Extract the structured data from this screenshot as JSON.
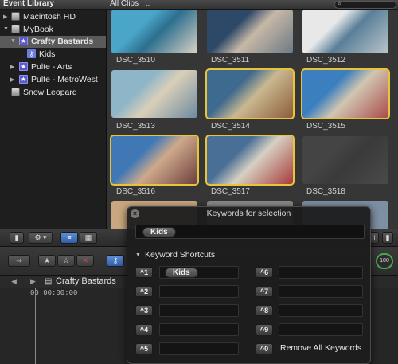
{
  "topbar": {
    "library_title": "Event Library",
    "clips_filter": "All Clips",
    "clips_chevron": "⌄",
    "search_glyph": "⌕"
  },
  "sidebar": {
    "items": [
      {
        "label": "Macintosh HD",
        "icon": "hard-disk-icon"
      },
      {
        "label": "MyBook",
        "icon": "hard-disk-icon"
      },
      {
        "label": "Crafty Bastards",
        "icon": "event-star-icon",
        "selected": true
      },
      {
        "label": "Kids",
        "icon": "keyword-collection-icon"
      },
      {
        "label": "Pulte - Arts",
        "icon": "event-star-icon"
      },
      {
        "label": "Pulte - MetroWest",
        "icon": "event-star-icon"
      },
      {
        "label": "Snow Leopard",
        "icon": "hard-disk-icon"
      }
    ]
  },
  "browser": {
    "clips": [
      {
        "name": "DSC_3510",
        "selected": false,
        "colors": [
          "#4aa6c9",
          "#2d6f8f",
          "#d9d3c4"
        ]
      },
      {
        "name": "DSC_3511",
        "selected": false,
        "colors": [
          "#2e4968",
          "#c7b8a6",
          "#6c7a86"
        ]
      },
      {
        "name": "DSC_3512",
        "selected": false,
        "colors": [
          "#e8e8e8",
          "#5a7f99",
          "#b9c5c9"
        ]
      },
      {
        "name": "DSC_3513",
        "selected": false,
        "colors": [
          "#8fb5c8",
          "#d9cfb8",
          "#6c8aa0"
        ]
      },
      {
        "name": "DSC_3514",
        "selected": true,
        "colors": [
          "#3f6a8f",
          "#c9b890",
          "#8d5c3a"
        ]
      },
      {
        "name": "DSC_3515",
        "selected": true,
        "colors": [
          "#3c7fbf",
          "#d1c6b0",
          "#a94b4b"
        ]
      },
      {
        "name": "DSC_3516",
        "selected": true,
        "colors": [
          "#3f78b5",
          "#cfa98a",
          "#6a3e3e"
        ]
      },
      {
        "name": "DSC_3517",
        "selected": true,
        "colors": [
          "#4a6f96",
          "#d7d0c2",
          "#a73a3a"
        ]
      },
      {
        "name": "DSC_3518",
        "selected": false,
        "colors": [
          "#444444",
          "#3a3a3a",
          "#4a4a4a"
        ]
      }
    ]
  },
  "timeline": {
    "project_name": "Crafty Bastards",
    "timecode": "00:00:00:00"
  },
  "hud": {
    "title": "Keywords for selection",
    "close_glyph": "×",
    "applied_keyword": "Kids",
    "section_label": "Keyword Shortcuts",
    "shortcuts": [
      {
        "key": "^1",
        "keyword": "Kids"
      },
      {
        "key": "^2",
        "keyword": ""
      },
      {
        "key": "^3",
        "keyword": ""
      },
      {
        "key": "^4",
        "keyword": ""
      },
      {
        "key": "^5",
        "keyword": ""
      },
      {
        "key": "^6",
        "keyword": ""
      },
      {
        "key": "^7",
        "keyword": ""
      },
      {
        "key": "^8",
        "keyword": ""
      },
      {
        "key": "^9",
        "keyword": ""
      },
      {
        "key": "^0",
        "keyword": ""
      }
    ],
    "remove_all_label": "Remove All Keywords"
  },
  "toolbar": {
    "level_readout": "100"
  },
  "accent": {
    "selection": "#e8c43a",
    "active_button": "#3a6fc0"
  }
}
